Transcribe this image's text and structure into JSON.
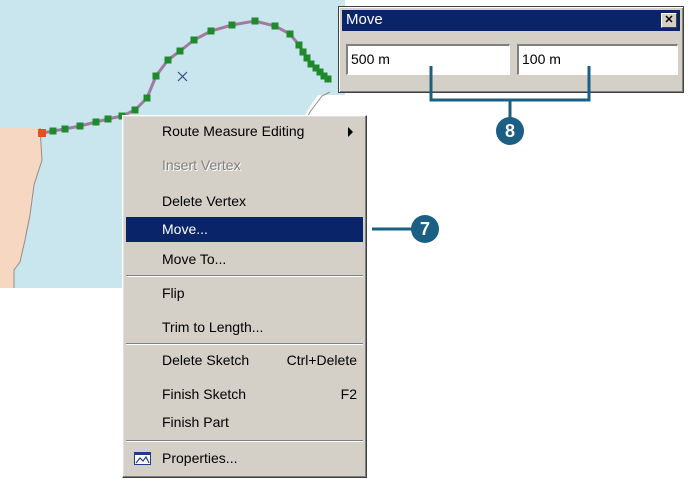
{
  "colors": {
    "water": "#c9e6ef",
    "land": "#f6d7c2",
    "route": "#a17aa0",
    "vertex": "#1f8a2b",
    "start_vertex": "#e0531f",
    "menu_bg": "#d4d0c8",
    "highlight": "#0a246a",
    "callout": "#1b5f84"
  },
  "map": {
    "cursor_icon": "x-cursor-icon"
  },
  "context_menu": {
    "items": [
      {
        "label": "Route Measure Editing",
        "shortcut": "",
        "submenu": true,
        "disabled": false
      },
      {
        "label": "Insert Vertex",
        "shortcut": "",
        "disabled": true
      },
      {
        "label": "Delete Vertex",
        "shortcut": "",
        "disabled": false
      },
      {
        "label": "Move...",
        "shortcut": "",
        "disabled": false,
        "selected": true
      },
      {
        "label": "Move To...",
        "shortcut": "",
        "disabled": false
      },
      {
        "label": "Flip",
        "shortcut": "",
        "disabled": false
      },
      {
        "label": "Trim to Length...",
        "shortcut": "",
        "disabled": false
      },
      {
        "label": "Delete Sketch",
        "shortcut": "Ctrl+Delete",
        "disabled": false
      },
      {
        "label": "Finish Sketch",
        "shortcut": "F2",
        "disabled": false
      },
      {
        "label": "Finish Part",
        "shortcut": "",
        "disabled": false
      },
      {
        "label": "Properties...",
        "shortcut": "",
        "icon": "properties-icon",
        "disabled": false
      }
    ]
  },
  "move_dialog": {
    "title": "Move",
    "close_label": "✕",
    "x_value": "500 m",
    "y_value": "100 m"
  },
  "callouts": {
    "step7": "7",
    "step8": "8"
  }
}
